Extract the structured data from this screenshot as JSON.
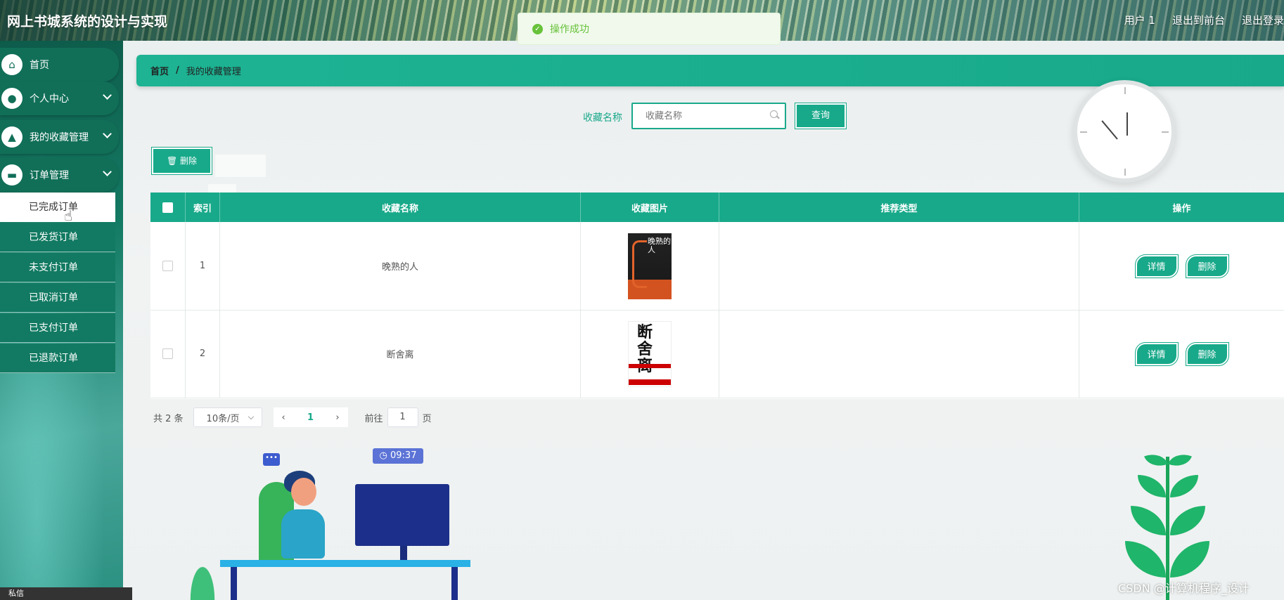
{
  "header": {
    "site_title": "网上书城系统的设计与实现",
    "user_label": "用户 1",
    "to_front_label": "退出到前台",
    "logout_label": "退出登录"
  },
  "toast": {
    "message": "操作成功",
    "icon": "check-circle-icon",
    "color": "#67c23a"
  },
  "sidebar": {
    "items": [
      {
        "label": "首页",
        "icon": "home-icon"
      },
      {
        "label": "个人中心",
        "icon": "user-icon"
      },
      {
        "label": "我的收藏管理",
        "icon": "user-badge-icon"
      },
      {
        "label": "订单管理",
        "icon": "monitor-icon"
      }
    ],
    "sub_items": [
      "已完成订单",
      "已发货订单",
      "未支付订单",
      "已取消订单",
      "已支付订单",
      "已退款订单"
    ],
    "active_sub": "已完成订单",
    "bottom_text": "私信"
  },
  "breadcrumb": {
    "home": "首页",
    "separator": "/",
    "current": "我的收藏管理"
  },
  "search": {
    "label": "收藏名称",
    "placeholder": "收藏名称",
    "button": "查询"
  },
  "toolbar": {
    "delete_label": "删除",
    "delete_icon": "trash-icon"
  },
  "table": {
    "columns": [
      "",
      "索引",
      "收藏名称",
      "收藏图片",
      "推荐类型",
      "操作"
    ],
    "rows": [
      {
        "index": "1",
        "name": "晚熟的人",
        "image": "book-cover-wanshu",
        "type": "",
        "detail": "详情",
        "delete": "删除"
      },
      {
        "index": "2",
        "name": "断舍离",
        "image": "book-cover-duansheli",
        "type": "",
        "detail": "详情",
        "delete": "删除"
      }
    ],
    "book_covers": {
      "book1_title": "晚熟的人",
      "book2_title": "断舍离"
    }
  },
  "pagination": {
    "total": "共 2 条",
    "page_size": "10条/页",
    "current_page": "1",
    "goto_label": "前往",
    "goto_value": "1",
    "page_suffix": "页"
  },
  "illustration": {
    "time": "09:37",
    "chat_dots": "•••"
  },
  "watermark": "CSDN @计算机程序_设计",
  "colors": {
    "primary": "#18a98a",
    "sidebar": "#116f58",
    "success": "#67c23a"
  }
}
